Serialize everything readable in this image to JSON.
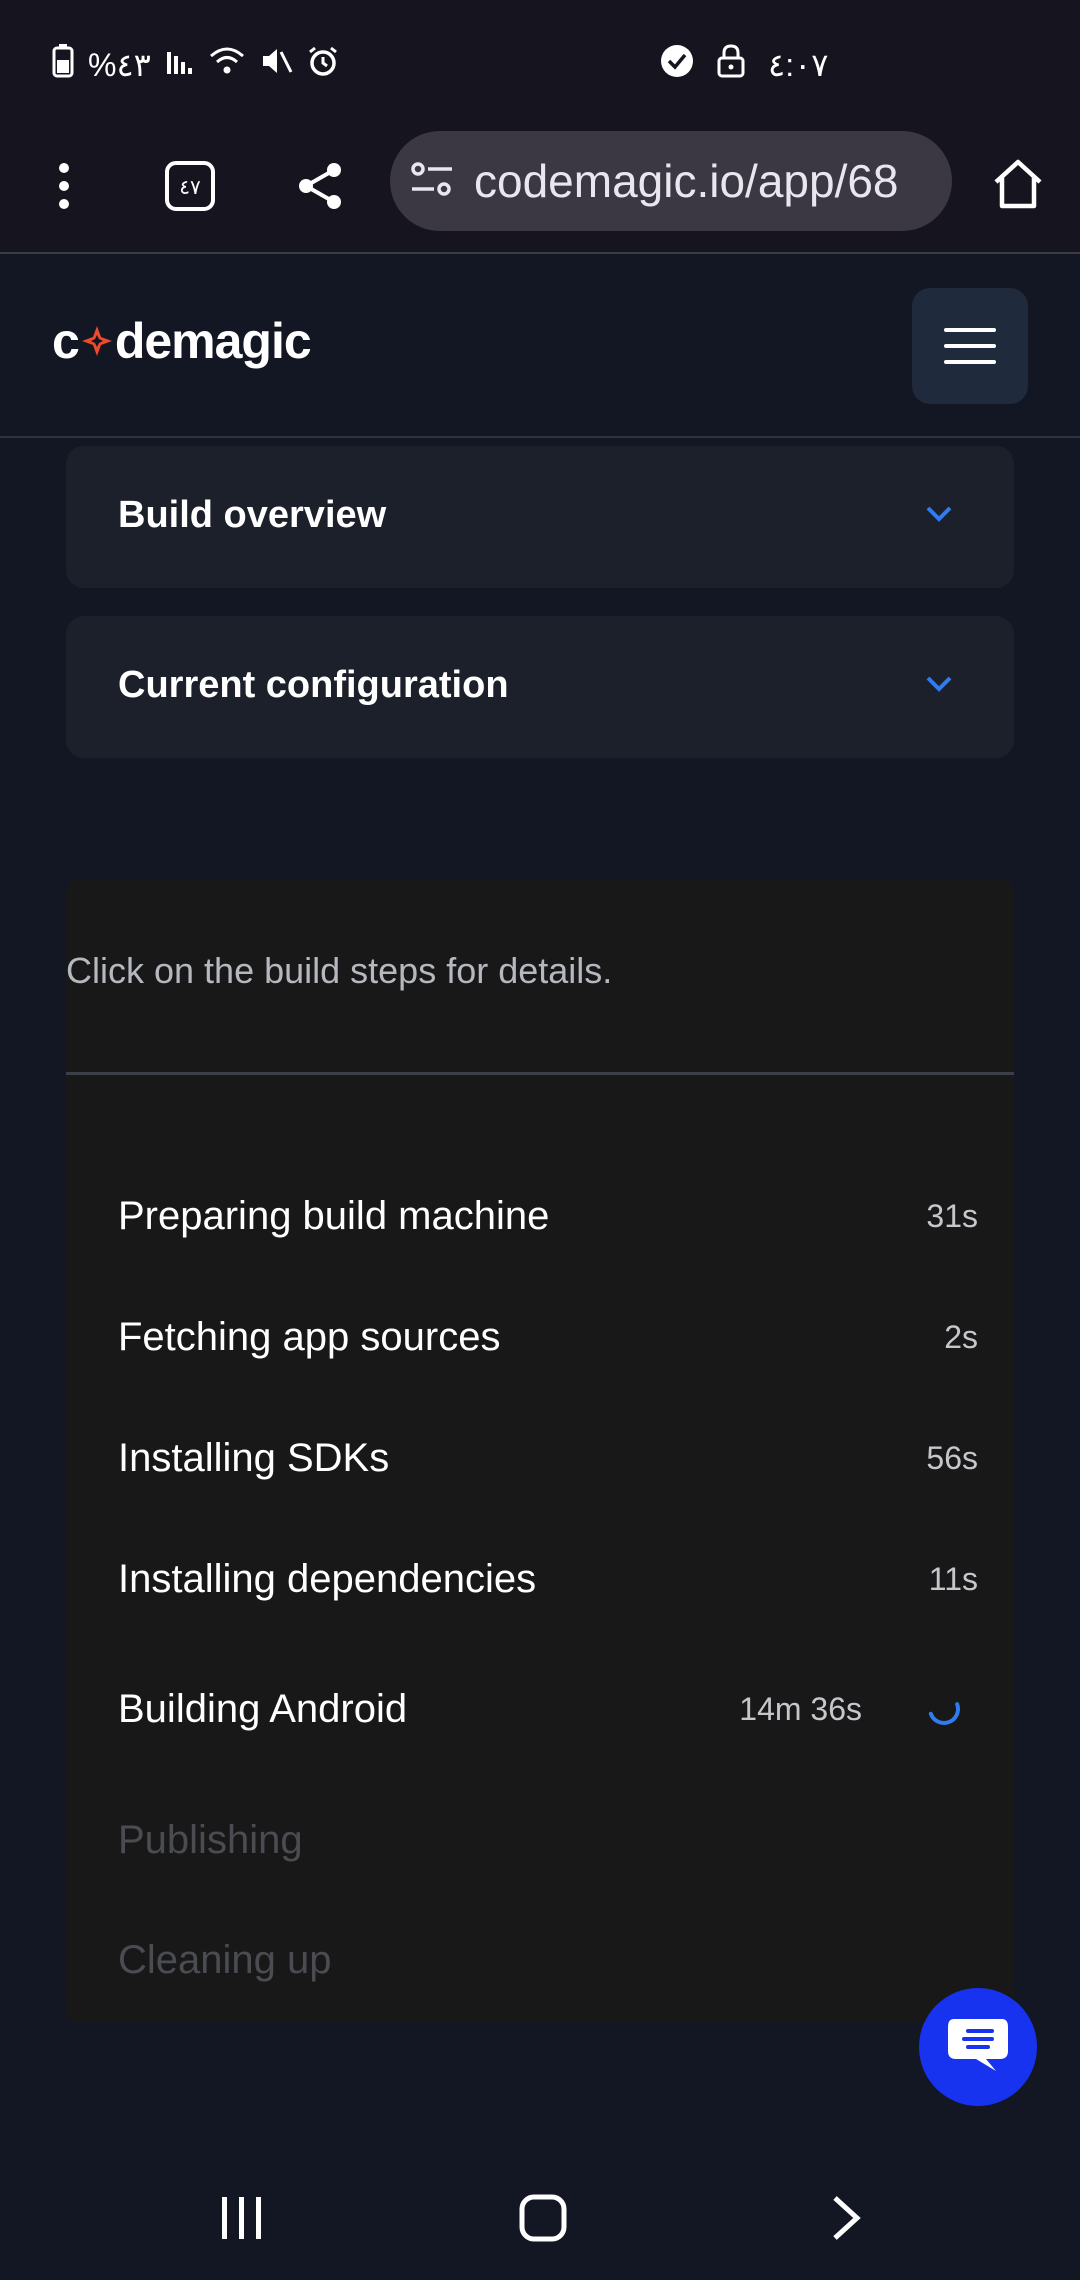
{
  "status_bar": {
    "battery_percent": "%٤٣",
    "time": "٤:٠٧",
    "app_badge": "٤٧"
  },
  "browser": {
    "url": "codemagic.io/app/68"
  },
  "site": {
    "logo_text_pre": "c",
    "logo_text_post": "demagic"
  },
  "cards": [
    {
      "title": "Build overview"
    },
    {
      "title": "Current configuration"
    }
  ],
  "steps_panel": {
    "hint": "Click on the build steps for details.",
    "steps": [
      {
        "label": "Preparing build machine",
        "time": "31s",
        "state": "done"
      },
      {
        "label": "Fetching app sources",
        "time": "2s",
        "state": "done"
      },
      {
        "label": "Installing SDKs",
        "time": "56s",
        "state": "done"
      },
      {
        "label": "Installing dependencies",
        "time": "11s",
        "state": "done"
      },
      {
        "label": "Building Android",
        "time": "14m 36s",
        "state": "running"
      },
      {
        "label": "Publishing",
        "time": "",
        "state": "pending"
      },
      {
        "label": "Cleaning up",
        "time": "",
        "state": "pending"
      }
    ]
  },
  "colors": {
    "accent": "#2f7bf0",
    "chat_fab": "#1733f0",
    "logo_star": "#ef4a2b"
  },
  "icons": [
    "battery-icon",
    "signal-icon",
    "wifi-icon",
    "mute-icon",
    "alarm-icon",
    "check-circle-icon",
    "lock-icon",
    "more-vert-icon",
    "tab-switcher-icon",
    "share-icon",
    "site-settings-icon",
    "home-icon",
    "menu-icon",
    "chevron-down-icon",
    "spinner-icon",
    "chat-icon",
    "recents-icon",
    "home-nav-icon",
    "back-icon"
  ]
}
